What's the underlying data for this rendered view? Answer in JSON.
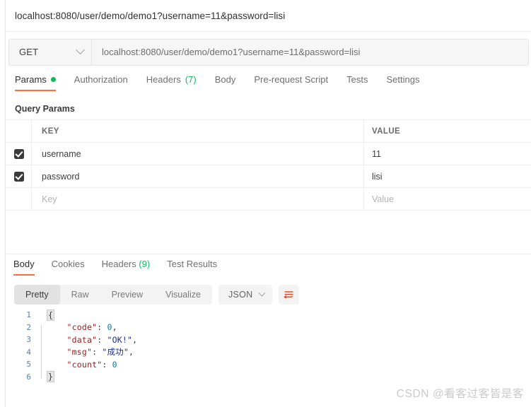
{
  "titlebar": {
    "url_preview": "localhost:8080/user/demo/demo1?username=11&password=lisi"
  },
  "request": {
    "method": "GET",
    "method_icon": "chevron-down-icon",
    "url_value": "localhost:8080/user/demo/demo1?username=11&password=lisi",
    "tabs": [
      {
        "label": "Params",
        "badge": "",
        "dot": true,
        "active": true
      },
      {
        "label": "Authorization",
        "badge": "",
        "dot": false,
        "active": false
      },
      {
        "label": "Headers",
        "badge": "(7)",
        "dot": false,
        "active": false
      },
      {
        "label": "Body",
        "badge": "",
        "dot": false,
        "active": false
      },
      {
        "label": "Pre-request Script",
        "badge": "",
        "dot": false,
        "active": false
      },
      {
        "label": "Tests",
        "badge": "",
        "dot": false,
        "active": false
      },
      {
        "label": "Settings",
        "badge": "",
        "dot": false,
        "active": false
      }
    ]
  },
  "query_params": {
    "section_title": "Query Params",
    "columns": {
      "key": "KEY",
      "value": "VALUE"
    },
    "rows": [
      {
        "checked": true,
        "key": "username",
        "value": "11",
        "placeholder_row": false
      },
      {
        "checked": true,
        "key": "password",
        "value": "lisi",
        "placeholder_row": false
      },
      {
        "checked": false,
        "key": "Key",
        "value": "Value",
        "placeholder_row": true
      }
    ]
  },
  "response": {
    "tabs": [
      {
        "label": "Body",
        "badge": "",
        "active": true
      },
      {
        "label": "Cookies",
        "badge": "",
        "active": false
      },
      {
        "label": "Headers",
        "badge": "(9)",
        "active": false
      },
      {
        "label": "Test Results",
        "badge": "",
        "active": false
      }
    ],
    "format_modes": [
      {
        "label": "Pretty",
        "active": true
      },
      {
        "label": "Raw",
        "active": false
      },
      {
        "label": "Preview",
        "active": false
      },
      {
        "label": "Visualize",
        "active": false
      }
    ],
    "language": "JSON",
    "language_icon": "chevron-down-icon",
    "wrap_icon": "wrap-lines-icon",
    "body_lines": [
      {
        "no": "1",
        "brace": "{",
        "text": ""
      },
      {
        "no": "2",
        "brace": "",
        "key": "\"code\"",
        "sep": ": ",
        "val": "0",
        "val_type": "num",
        "tail": ","
      },
      {
        "no": "3",
        "brace": "",
        "key": "\"data\"",
        "sep": ": ",
        "val": "\"OK!\"",
        "val_type": "str",
        "tail": ","
      },
      {
        "no": "4",
        "brace": "",
        "key": "\"msg\"",
        "sep": ": ",
        "val": "\"成功\"",
        "val_type": "str",
        "tail": ","
      },
      {
        "no": "5",
        "brace": "",
        "key": "\"count\"",
        "sep": ": ",
        "val": "0",
        "val_type": "num",
        "tail": ""
      },
      {
        "no": "6",
        "brace": "}",
        "text": ""
      }
    ]
  },
  "watermark": {
    "text": "CSDN @看客过客皆是客"
  },
  "colors": {
    "accent": "#ff6c37",
    "green": "#14b866",
    "json_key": "#9a1b1b",
    "json_string": "#1a2e8f",
    "json_number": "#0d7a99",
    "gutter": "#5b7fa6"
  }
}
